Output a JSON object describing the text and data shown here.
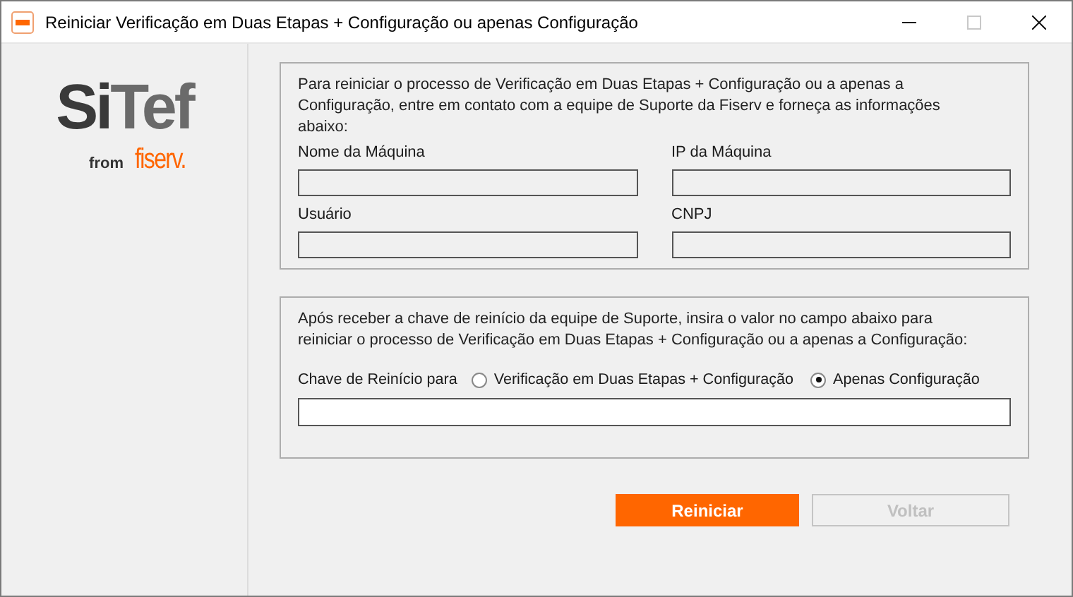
{
  "window": {
    "title": "Reiniciar Verificação em Duas Etapas + Configuração ou apenas Configuração",
    "controls": [
      {
        "kind": "minimize",
        "disabled": false
      },
      {
        "kind": "maximize",
        "disabled": true
      },
      {
        "kind": "close",
        "disabled": false
      }
    ]
  },
  "logo": {
    "name_dark": "Si",
    "name_grey": "Tef",
    "from": "from",
    "brand": "fiserv."
  },
  "info_group": {
    "text": "Para reiniciar o processo de Verificação em Duas Etapas + Configuração ou a apenas a Configuração, entre em contato com a equipe de Suporte da Fiserv e forneça as informações abaixo:",
    "fields": [
      {
        "label": "Nome da Máquina"
      },
      {
        "label": "IP da Máquina"
      },
      {
        "label": "Usuário"
      },
      {
        "label": "CNPJ"
      }
    ]
  },
  "key_group": {
    "text": "Após receber a chave de reinício da equipe de Suporte, insira o valor no campo abaixo para reiniciar o processo de Verificação em Duas Etapas + Configuração ou a apenas a Configuração:",
    "radio_label": "Chave de Reinício para",
    "options": [
      {
        "label": "Verificação em Duas Etapas + Configuração",
        "selected": false
      },
      {
        "label": "Apenas Configuração",
        "selected": true
      }
    ]
  },
  "buttons": [
    {
      "label": "Reiniciar",
      "kind": "primary",
      "disabled": false
    },
    {
      "label": "Voltar",
      "kind": "secondary",
      "disabled": true
    }
  ]
}
